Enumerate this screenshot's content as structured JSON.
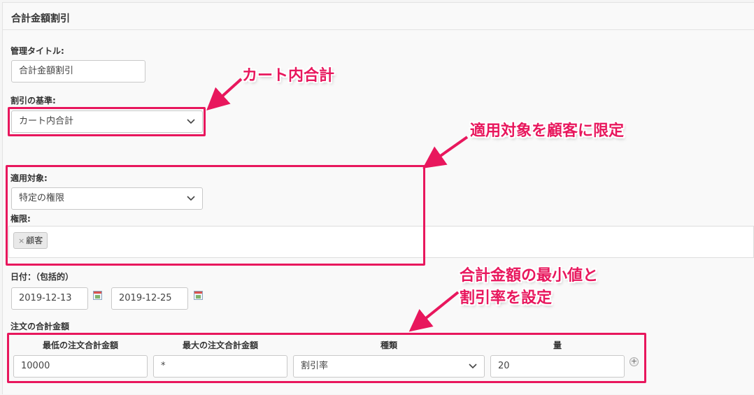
{
  "page_title": "合計金額割引",
  "admin_title": {
    "label": "管理タイトル:",
    "value": "合計金額割引"
  },
  "discount_basis": {
    "label": "割引の基準:",
    "value": "カート内合計"
  },
  "apply_to": {
    "label": "適用対象:",
    "value": "特定の権限"
  },
  "roles": {
    "label": "権限:",
    "tags": [
      {
        "remove": "×",
        "label": "顧客"
      }
    ]
  },
  "date": {
    "label": "日付：（包括的）",
    "start": "2019-12-13",
    "end": "2019-12-25"
  },
  "order_total": {
    "label": "注文の合計金額",
    "headers": {
      "min": "最低の注文合計金額",
      "max": "最大の注文合計金額",
      "type": "種類",
      "amount": "量"
    },
    "row": {
      "min": "10000",
      "max": "*",
      "type": "割引率",
      "amount": "20"
    },
    "add_label": "+"
  },
  "callouts": {
    "cart_total": "カート内合計",
    "limit_to_customer": "適用対象を顧客に限定",
    "set_min_and_rate_line1": "合計金額の最小値と",
    "set_min_and_rate_line2": "割引率を設定"
  },
  "colors": {
    "accent": "#e8175d",
    "background": "#f9f9f9",
    "input_border": "#c9c9c9"
  },
  "icons": {
    "select": "chevron-down-icon",
    "date": "calendar-icon",
    "add": "plus-circle-icon",
    "tag_remove": "close-icon"
  }
}
